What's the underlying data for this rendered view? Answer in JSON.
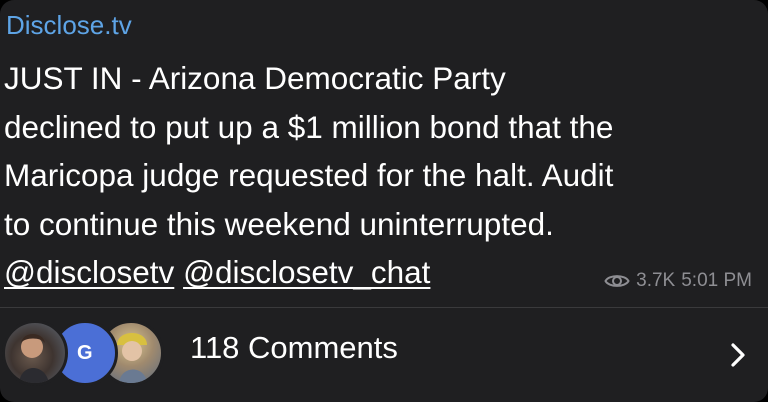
{
  "channel": {
    "name": "Disclose.tv"
  },
  "message": {
    "lines": [
      "JUST IN - Arizona Democratic Party",
      "declined to put up a $1 million bond that the",
      "Maricopa judge requested for the halt. Audit",
      "to continue this weekend uninterrupted."
    ],
    "handles": [
      "@disclosetv",
      "@disclosetv_chat"
    ],
    "views": "3.7K",
    "time": "5:01 PM"
  },
  "comments": {
    "avatar_initial": "G",
    "label": "118 Comments",
    "chevron_icon": "chevron-right-icon",
    "eye_icon": "eye-icon"
  },
  "colors": {
    "background": "#1f1f21",
    "channel_name": "#5ea4e6",
    "text": "#ffffff",
    "meta": "#8e8e93",
    "avatar_initial_bg": "#4b6fd6"
  }
}
